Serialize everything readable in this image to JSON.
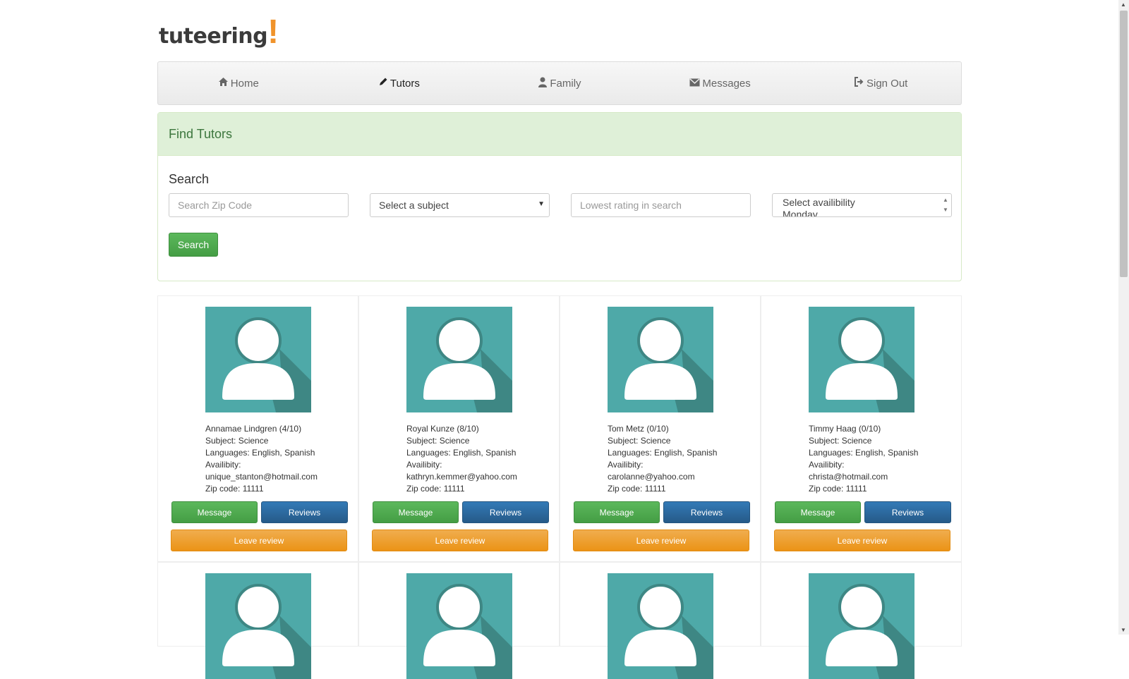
{
  "logo": {
    "text": "tuteering",
    "mark": "!"
  },
  "nav": [
    {
      "icon": "home-icon",
      "label": "Home",
      "active": false
    },
    {
      "icon": "pencil-icon",
      "label": "Tutors",
      "active": true
    },
    {
      "icon": "user-icon",
      "label": "Family",
      "active": false
    },
    {
      "icon": "envelope-icon",
      "label": "Messages",
      "active": false
    },
    {
      "icon": "sign-out-icon",
      "label": "Sign Out",
      "active": false
    }
  ],
  "panel": {
    "title": "Find Tutors",
    "search_label": "Search",
    "zip_placeholder": "Search Zip Code",
    "subject_selected": "Select a subject",
    "rating_placeholder": "Lowest rating in search",
    "availability_options": [
      "Select availibility",
      "Monday"
    ],
    "search_button": "Search"
  },
  "tutors": [
    {
      "name": "Annamae Lindgren (4/10)",
      "subject": "Subject: Science",
      "languages": "Languages: English, Spanish",
      "availability": "Availibity:",
      "email": "unique_stanton@hotmail.com",
      "zip": "Zip code: 11111"
    },
    {
      "name": "Royal Kunze (8/10)",
      "subject": "Subject: Science",
      "languages": "Languages: English, Spanish",
      "availability": "Availibity:",
      "email": "kathryn.kemmer@yahoo.com",
      "zip": "Zip code: 11111"
    },
    {
      "name": "Tom Metz (0/10)",
      "subject": "Subject: Science",
      "languages": "Languages: English, Spanish",
      "availability": "Availibity:",
      "email": "carolanne@yahoo.com",
      "zip": "Zip code: 11111"
    },
    {
      "name": "Timmy Haag (0/10)",
      "subject": "Subject: Science",
      "languages": "Languages: English, Spanish",
      "availability": "Availibity:",
      "email": "christa@hotmail.com",
      "zip": "Zip code: 11111"
    }
  ],
  "card_buttons": {
    "message": "Message",
    "reviews": "Reviews",
    "leave_review": "Leave review"
  },
  "colors": {
    "avatar_bg": "#4ea9a8",
    "avatar_shadow": "#3e8784",
    "success": "#5cb85c",
    "primary": "#337ab7",
    "warning": "#f0ad4e",
    "panel_heading": "#dff0d8"
  }
}
